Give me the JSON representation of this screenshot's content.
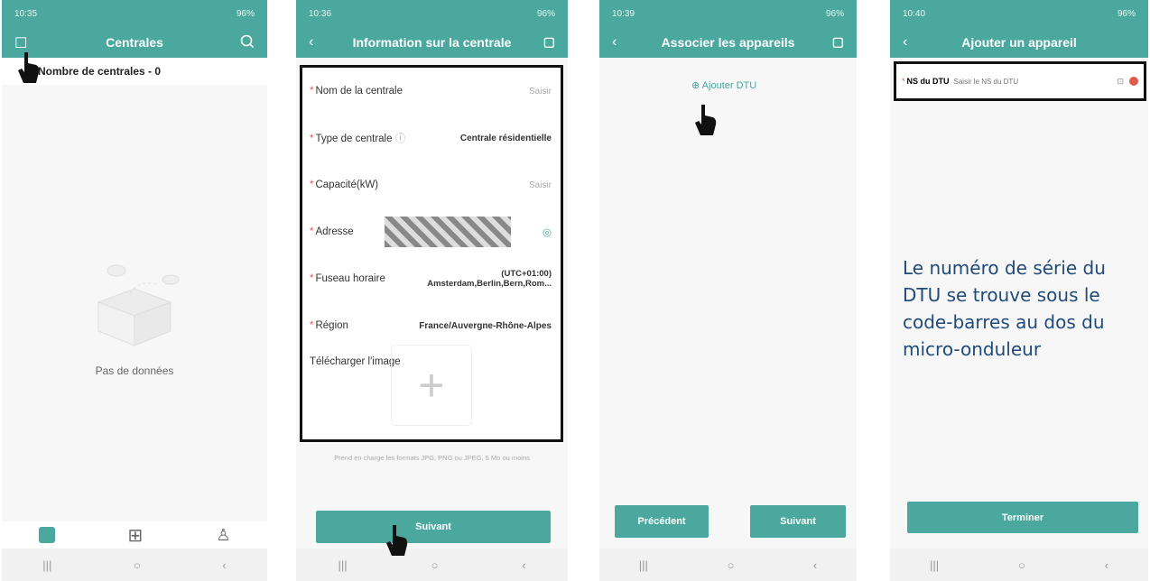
{
  "screens": [
    {
      "time": "10:35",
      "battery": "96%",
      "title": "Centrales",
      "count_label": "Nombre de centrales - 0",
      "empty": "Pas de données"
    },
    {
      "time": "10:36",
      "battery": "96%",
      "title": "Information sur la centrale",
      "rows": [
        {
          "label": "Nom de la centrale",
          "value": "Saisir"
        },
        {
          "label": "Type de centrale",
          "value": "Centrale résidentielle"
        },
        {
          "label": "Capacité(kW)",
          "value": "Saisir"
        },
        {
          "label": "Adresse",
          "value": ""
        },
        {
          "label": "Fuseau horaire",
          "value": "(UTC+01:00) Amsterdam,Berlin,Bern,Rom..."
        },
        {
          "label": "Région",
          "value": "France/Auvergne-Rhône-Alpes"
        }
      ],
      "upload_label": "Télécharger l'image",
      "formats": "Prend en charge les formats JPG, PNG ou JPEG, 5 Mo ou moins",
      "next": "Suivant"
    },
    {
      "time": "10:39",
      "battery": "96%",
      "title": "Associer les appareils",
      "add": "Ajouter DTU",
      "prev": "Précédent",
      "next": "Suivant"
    },
    {
      "time": "10:40",
      "battery": "96%",
      "title": "Ajouter un appareil",
      "field_label": "NS du DTU",
      "placeholder": "Saisir le NS du DTU",
      "finish": "Terminer"
    }
  ],
  "caption": "Le numéro de série du DTU se trouve sous le code-barres au dos du micro-onduleur",
  "colors": {
    "accent": "#4aa89e",
    "required": "#e25a4d"
  }
}
